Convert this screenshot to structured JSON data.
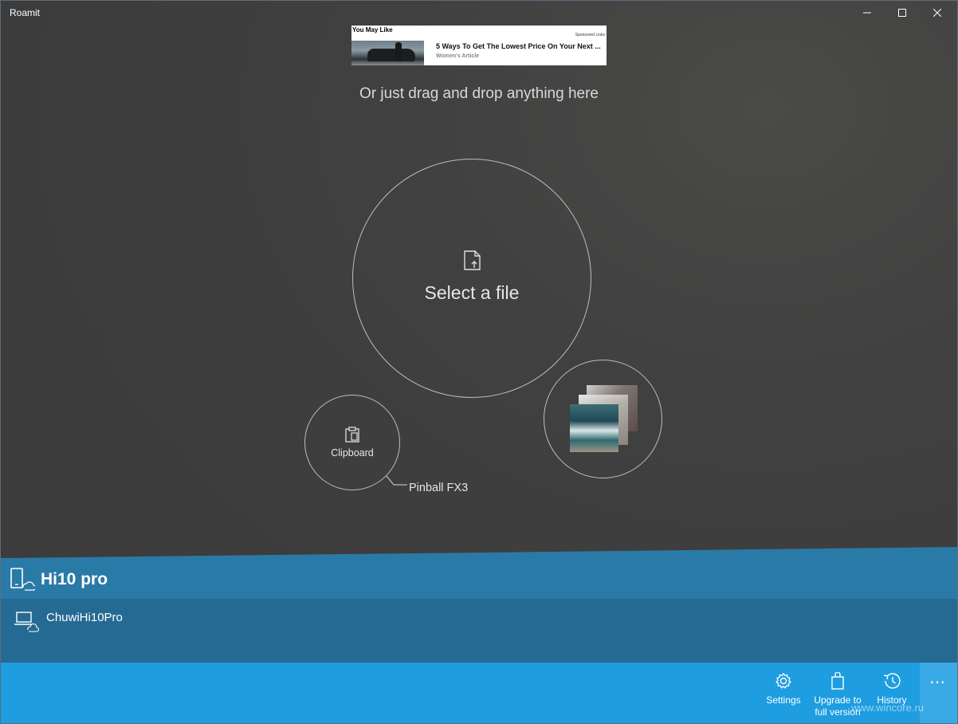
{
  "window": {
    "title": "Roamit",
    "controls": {
      "minimize": "minimize-icon",
      "maximize": "maximize-icon",
      "close": "close-icon"
    }
  },
  "ad": {
    "header": "You May Like",
    "sponsored": "Sponsored Links",
    "headline": "5 Ways To Get The Lowest Price On Your Next ...",
    "source": "Women's Article"
  },
  "main": {
    "drag_hint": "Or just drag and drop anything here",
    "select_file_label": "Select a file",
    "clipboard_label": "Clipboard",
    "recent_app": "Pinball FX3"
  },
  "devices": {
    "primary": "Hi10 pro",
    "secondary": "ChuwiHi10Pro"
  },
  "command_bar": {
    "settings": "Settings",
    "upgrade_line1": "Upgrade to",
    "upgrade_line2": "full version",
    "history": "History",
    "more": "⋯"
  },
  "watermark": "www.wincore.ru",
  "colors": {
    "accent": "#1e9de0",
    "device_header": "#2a7aa7",
    "device_row": "#256a93",
    "background": "#3f3f3f"
  }
}
